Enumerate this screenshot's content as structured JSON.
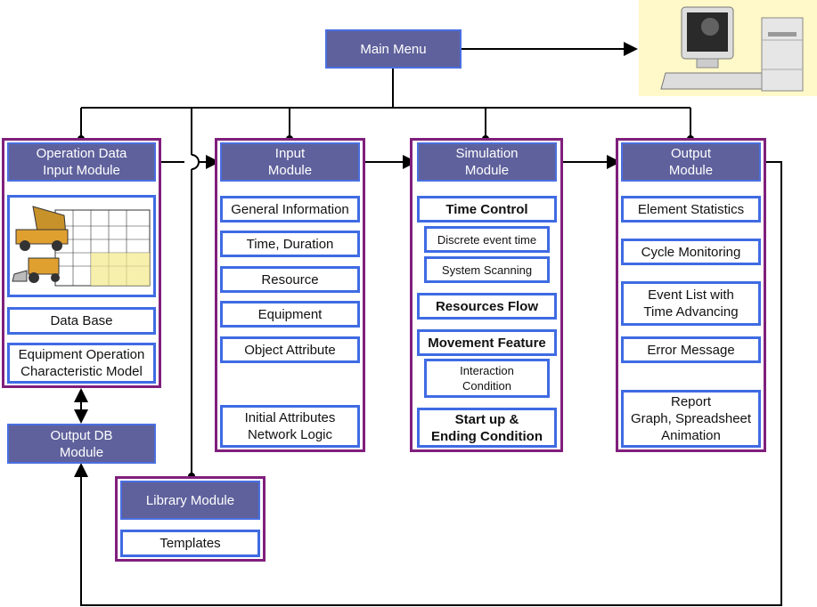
{
  "main_menu": "Main Menu",
  "operation_data_module": {
    "title": "Operation Data\nInput Module",
    "items": [
      "Data Base",
      "Equipment Operation\nCharacteristic Model"
    ]
  },
  "output_db_module": "Output DB\nModule",
  "input_module": {
    "title": "Input\nModule",
    "items": [
      "General Information",
      "Time, Duration",
      "Resource",
      "Equipment",
      "Object Attribute",
      "Initial Attributes\nNetwork Logic"
    ]
  },
  "simulation_module": {
    "title": "Simulation\nModule",
    "items": [
      "Time Control",
      "Discrete event time",
      "System Scanning",
      "Resources Flow",
      "Movement Feature",
      "Interaction\nCondition",
      "Start up &\nEnding Condition"
    ]
  },
  "output_module": {
    "title": "Output\nModule",
    "items": [
      "Element Statistics",
      "Cycle Monitoring",
      "Event List with\nTime Advancing",
      "Error Message",
      "Report\nGraph, Spreadsheet\nAnimation"
    ]
  },
  "library_module": {
    "title": "Library Module",
    "items": [
      "Templates"
    ]
  },
  "colors": {
    "header": "#5f619c",
    "outer_border": "#7f1f7c",
    "item_border": "#3f6be3",
    "computer_bg": "#fff8c8"
  }
}
